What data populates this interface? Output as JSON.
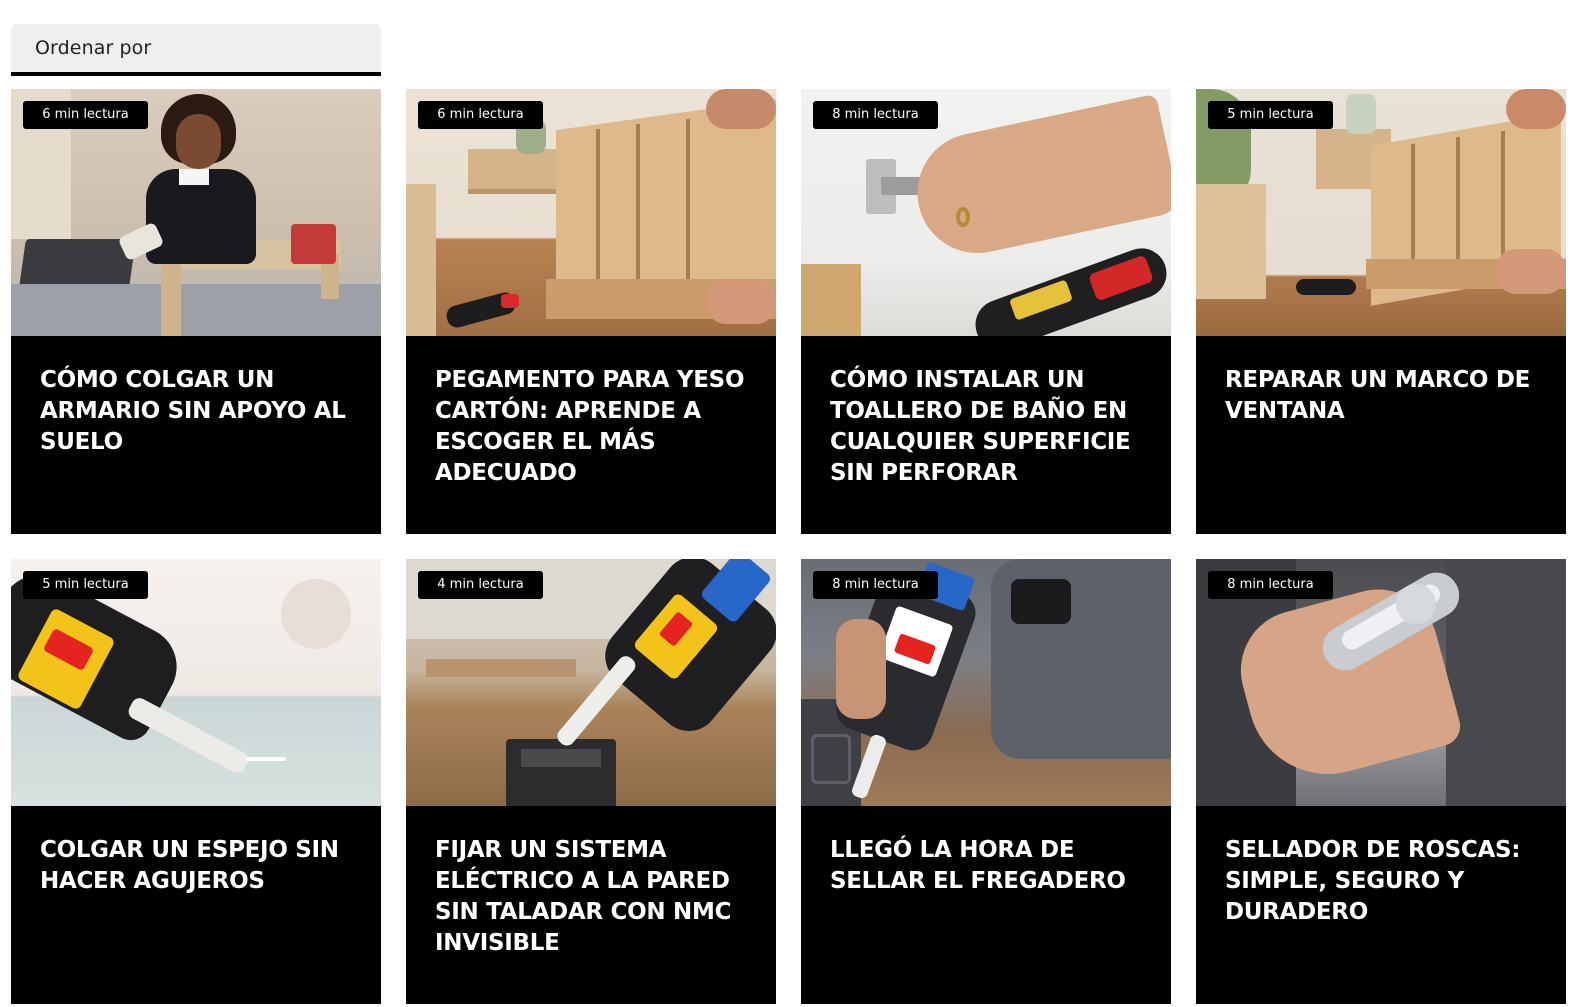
{
  "sort": {
    "label": "Ordenar por"
  },
  "cards": [
    {
      "read_time": "6 min lectura",
      "title": "CÓMO COLGAR UN ARMARIO SIN APOYO AL SUELO"
    },
    {
      "read_time": "6 min lectura",
      "title": "PEGAMENTO PARA YESO CARTÓN: APRENDE A ESCOGER EL MÁS ADECUADO"
    },
    {
      "read_time": "8 min lectura",
      "title": "CÓMO INSTALAR UN TOALLERO DE BAÑO EN CUALQUIER SUPERFICIE SIN PERFORAR"
    },
    {
      "read_time": "5 min lectura",
      "title": "REPARAR UN MARCO DE VENTANA"
    },
    {
      "read_time": "5 min lectura",
      "title": "COLGAR UN ESPEJO SIN HACER AGUJEROS"
    },
    {
      "read_time": "4 min lectura",
      "title": "FIJAR UN SISTEMA ELÉCTRICO A LA PARED SIN TALADAR CON NMC INVISIBLE"
    },
    {
      "read_time": "8 min lectura",
      "title": "LLEGÓ LA HORA DE SELLAR EL FREGADERO"
    },
    {
      "read_time": "8 min lectura",
      "title": "SELLADOR DE ROSCAS: SIMPLE, SEGURO Y DURADERO"
    }
  ]
}
